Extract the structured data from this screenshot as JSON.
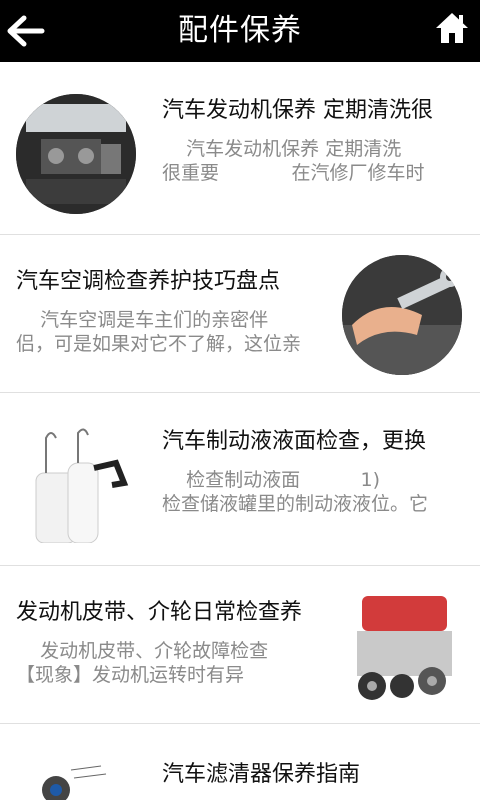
{
  "header": {
    "title": "配件保养"
  },
  "articles": [
    {
      "headline": "汽车发动机保养 定期清洗很",
      "summary_line1": "    汽车发动机保养 定期清洗",
      "summary_line2": "很重要            在汽修厂修车时",
      "image_icon": "engine-bay-photo"
    },
    {
      "headline": "汽车空调检查养护技巧盘点",
      "summary_line1": "    汽车空调是车主们的亲密伴",
      "summary_line2": "侣，可是如果对它不了解，这位亲",
      "image_icon": "wrench-repair-photo"
    },
    {
      "headline": "汽车制动液液面检查，更换",
      "summary_line1": "    检查制动液面          1)",
      "summary_line2": "检查储液罐里的制动液液位。它",
      "image_icon": "brake-fluid-tool-photo"
    },
    {
      "headline": "发动机皮带、介轮日常检查养",
      "summary_line1": "    发动机皮带、介轮故障检查",
      "summary_line2": "【现象】发动机运转时有异",
      "image_icon": "engine-belt-photo"
    },
    {
      "headline": "汽车滤清器保养指南",
      "image_icon": "filter-diagram-photo"
    }
  ]
}
